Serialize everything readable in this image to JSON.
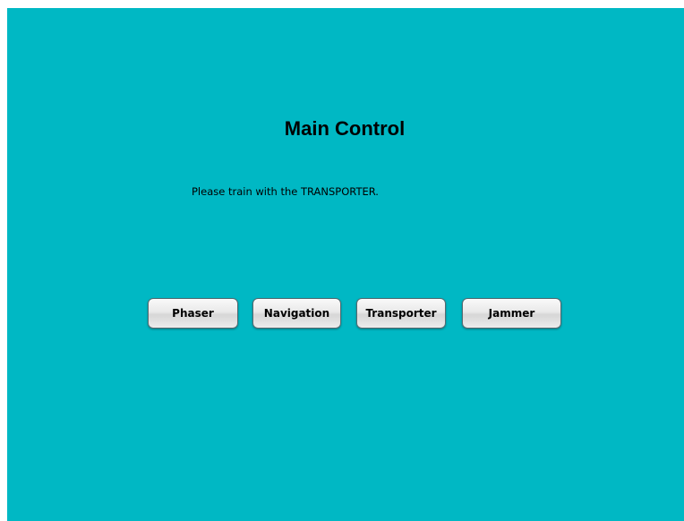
{
  "screen": {
    "title": "Main Control",
    "message": "Please train with the TRANSPORTER.",
    "background_color": "#00b8c4"
  },
  "buttons": {
    "phaser": "Phaser",
    "navigation": "Navigation",
    "transporter": "Transporter",
    "jammer": "Jammer"
  }
}
